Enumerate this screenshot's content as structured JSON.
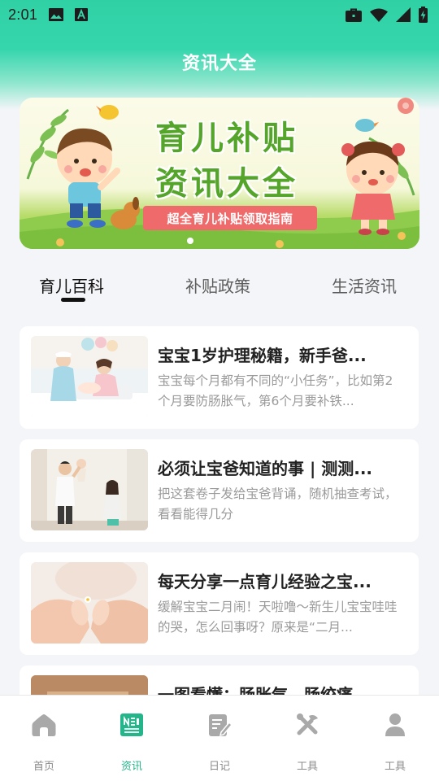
{
  "status_bar": {
    "time": "2:01",
    "icons": [
      "image-icon",
      "text-a-icon",
      "briefcase-icon",
      "wifi-icon",
      "signal-icon",
      "battery-charging-icon"
    ]
  },
  "header": {
    "title": "资讯大全"
  },
  "banner": {
    "title_line1": "育儿补贴",
    "title_line2": "资讯大全",
    "ribbon": "超全育儿补贴领取指南",
    "colors": {
      "title": "#55a52a",
      "ribbon": "#ef6b6b"
    }
  },
  "tabs": [
    {
      "label": "育儿百科",
      "active": true
    },
    {
      "label": "补贴政策",
      "active": false
    },
    {
      "label": "生活资讯",
      "active": false
    }
  ],
  "articles": [
    {
      "title": "宝宝1岁护理秘籍，新手爸...",
      "desc": "宝宝每个月都有不同的“小任务”，比如第2个月要防肠胀气，第6个月要补铁..."
    },
    {
      "title": "必须让宝爸知道的事 | 测测...",
      "desc": "把这套卷子发给宝爸背诵，随机抽查考试，看看能得几分"
    },
    {
      "title": "每天分享一点育儿经验之宝...",
      "desc": "缓解宝宝二月闹！天啦噜～新生儿宝宝哇哇的哭，怎么回事呀？原来是“二月..."
    },
    {
      "title": "一图看懂：肠胀气、肠绞痛",
      "desc": ""
    }
  ],
  "bottom_nav": [
    {
      "label": "首页",
      "icon": "home-icon",
      "active": false
    },
    {
      "label": "资讯",
      "icon": "news-icon",
      "active": true
    },
    {
      "label": "日记",
      "icon": "diary-icon",
      "active": false
    },
    {
      "label": "工具",
      "icon": "tools-icon",
      "active": false
    },
    {
      "label": "工具",
      "icon": "user-icon",
      "active": false
    }
  ],
  "colors": {
    "accent": "#25b58a",
    "header_gradient_top": "#2fd1a4"
  }
}
